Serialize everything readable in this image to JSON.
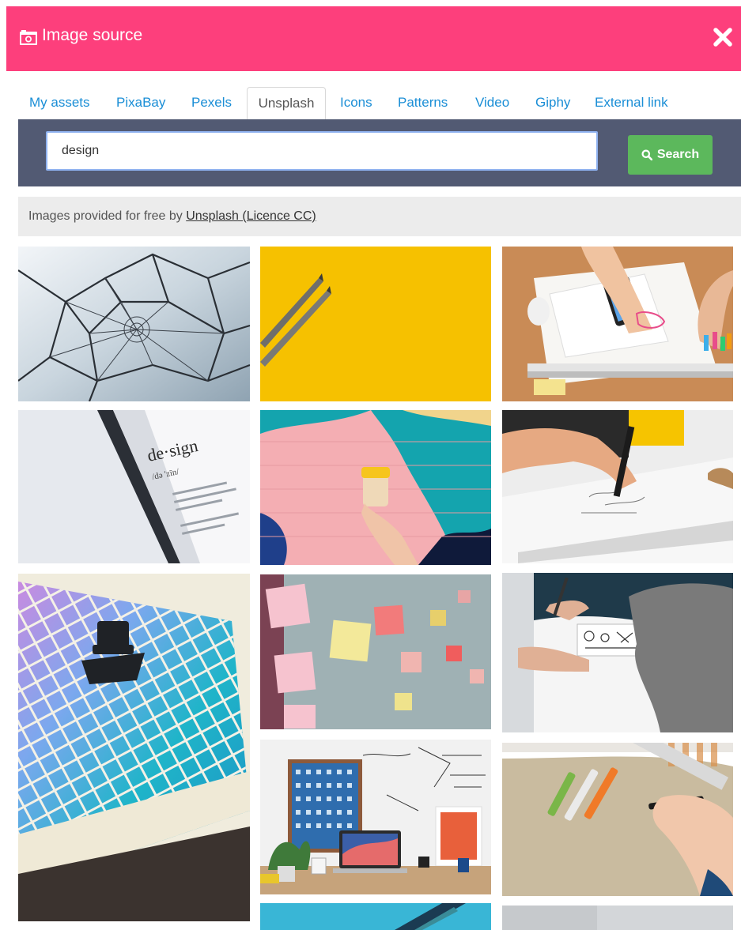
{
  "modal": {
    "title": "Image source",
    "header_color": "#fd3f7c",
    "header_icon": "camera-icon",
    "close_icon": "close-icon"
  },
  "tabs": [
    {
      "label": "My assets",
      "active": false
    },
    {
      "label": "PixaBay",
      "active": false
    },
    {
      "label": "Pexels",
      "active": false
    },
    {
      "label": "Unsplash",
      "active": true
    },
    {
      "label": "Icons",
      "active": false
    },
    {
      "label": "Patterns",
      "active": false
    },
    {
      "label": "Video",
      "active": false
    },
    {
      "label": "Giphy",
      "active": false
    },
    {
      "label": "External link",
      "active": false
    }
  ],
  "search": {
    "value": "design",
    "button_label": "Search",
    "button_icon": "search-icon",
    "button_color": "#5cb85c"
  },
  "credit": {
    "text": "Images provided for free by ",
    "link_label": "Unsplash (Licence CC)"
  },
  "results": {
    "columns": [
      [
        {
          "name": "wire-geodesic-structure"
        },
        {
          "name": "phone-design-definition"
        },
        {
          "name": "color-chart-loupe"
        }
      ],
      [
        {
          "name": "pencils-on-yellow"
        },
        {
          "name": "hand-cup-colorful-wall"
        },
        {
          "name": "sticky-notes-wall"
        },
        {
          "name": "desk-laptop-frames"
        },
        {
          "name": "teal-architecture-partial"
        }
      ],
      [
        {
          "name": "designers-sketching-table"
        },
        {
          "name": "hand-drawing-sketch"
        },
        {
          "name": "person-sketching-notebook"
        },
        {
          "name": "hand-drawing-markers"
        },
        {
          "name": "gray-partial"
        }
      ]
    ]
  }
}
